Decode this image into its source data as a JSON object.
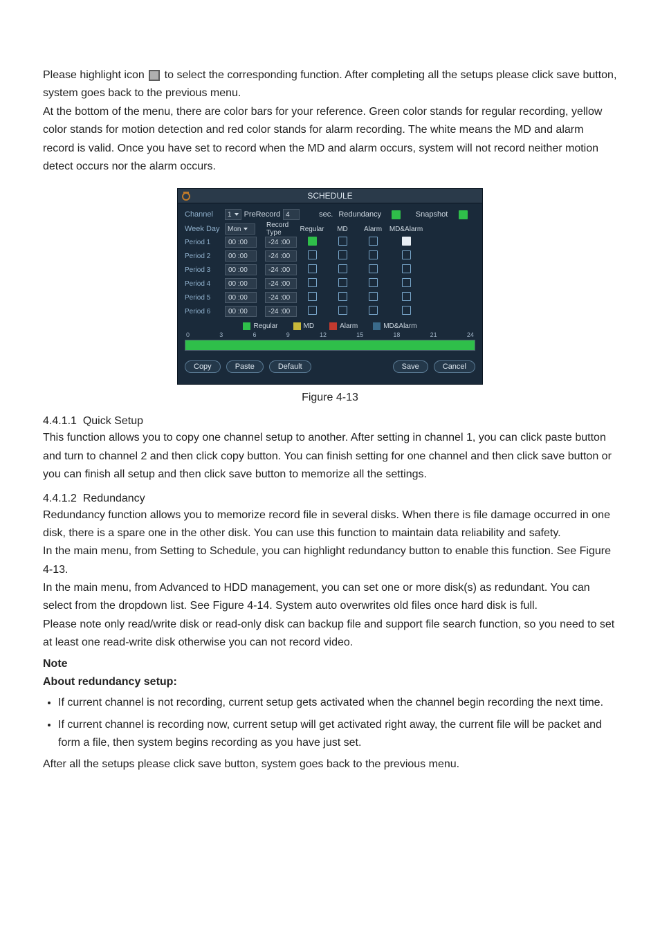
{
  "intro": {
    "p1a": "Please highlight icon ",
    "p1b": " to select the corresponding function. After completing all the setups please click save button, system goes back to the previous menu.",
    "p2": "At the bottom of the menu, there are color bars for your reference. Green color stands for regular recording, yellow color stands for motion detection and red color stands for alarm recording. The white means the MD and alarm record is valid. Once you have set to record when the MD and alarm occurs, system will not record neither motion detect occurs nor the alarm occurs."
  },
  "dvr": {
    "title": "SCHEDULE",
    "row1": {
      "channel_label": "Channel",
      "channel_value": "1",
      "prerecord_label": "PreRecord",
      "prerecord_value": "4",
      "sec_label": "sec.",
      "redundancy_label": "Redundancy",
      "snapshot_label": "Snapshot"
    },
    "row2": {
      "weekday_label": "Week Day",
      "weekday_value": "Mon",
      "recordtype_label": "Record Type",
      "cols": [
        "Regular",
        "MD",
        "Alarm",
        "MD&Alarm"
      ]
    },
    "periods": [
      {
        "label": "Period 1",
        "t1": "00 :00",
        "t2": "-24  :00",
        "regular": true,
        "md": false,
        "alarm": false,
        "mdalarm": true
      },
      {
        "label": "Period 2",
        "t1": "00 :00",
        "t2": "-24  :00",
        "regular": false,
        "md": false,
        "alarm": false,
        "mdalarm": false
      },
      {
        "label": "Period 3",
        "t1": "00 :00",
        "t2": "-24  :00",
        "regular": false,
        "md": false,
        "alarm": false,
        "mdalarm": false
      },
      {
        "label": "Period 4",
        "t1": "00 :00",
        "t2": "-24  :00",
        "regular": false,
        "md": false,
        "alarm": false,
        "mdalarm": false
      },
      {
        "label": "Period 5",
        "t1": "00 :00",
        "t2": "-24  :00",
        "regular": false,
        "md": false,
        "alarm": false,
        "mdalarm": false
      },
      {
        "label": "Period 6",
        "t1": "00 :00",
        "t2": "-24  :00",
        "regular": false,
        "md": false,
        "alarm": false,
        "mdalarm": false
      }
    ],
    "legend": [
      "Regular",
      "MD",
      "Alarm",
      "MD&Alarm"
    ],
    "axis": [
      "0",
      "3",
      "6",
      "9",
      "12",
      "15",
      "18",
      "21",
      "24"
    ],
    "buttons": {
      "copy": "Copy",
      "paste": "Paste",
      "default": "Default",
      "save": "Save",
      "cancel": "Cancel"
    }
  },
  "figcaption": "Figure 4-13",
  "s1": {
    "num": "4.4.1.1",
    "title": "Quick Setup",
    "p": "This function allows you to copy one channel setup to another. After setting in channel 1, you can click paste button and turn to channel 2 and then click copy button. You can finish setting for one channel and then click save button or you can finish all setup and then click save button to memorize all the settings."
  },
  "s2": {
    "num": "4.4.1.2",
    "title": "Redundancy",
    "p1": "Redundancy function allows you to memorize record file in several disks. When there is file damage occurred in one disk, there is a spare one in the other disk. You can use this function to maintain data reliability and safety.",
    "p2": "In the main menu, from Setting to Schedule, you can highlight redundancy button to enable this function. See Figure 4-13.",
    "p3": "In the main menu, from Advanced to HDD management, you can set one or more disk(s) as redundant. You can select from the dropdown list. See Figure 4-14. System auto overwrites old files once hard disk is full.",
    "p4": "Please note only read/write disk or read-only disk can backup file and support file search function, so you need to set at least one read-write disk otherwise you can not record video.",
    "note": "Note",
    "about": "About redundancy setup:",
    "b1": "If current channel is not recording, current setup gets activated when the channel begin recording the next time.",
    "b2": "If current channel is recording now, current setup will get activated right away, the current file will be packet and form a file, then system begins recording as you have just set.",
    "after": "After all the setups please click save button, system goes back to the previous menu."
  }
}
